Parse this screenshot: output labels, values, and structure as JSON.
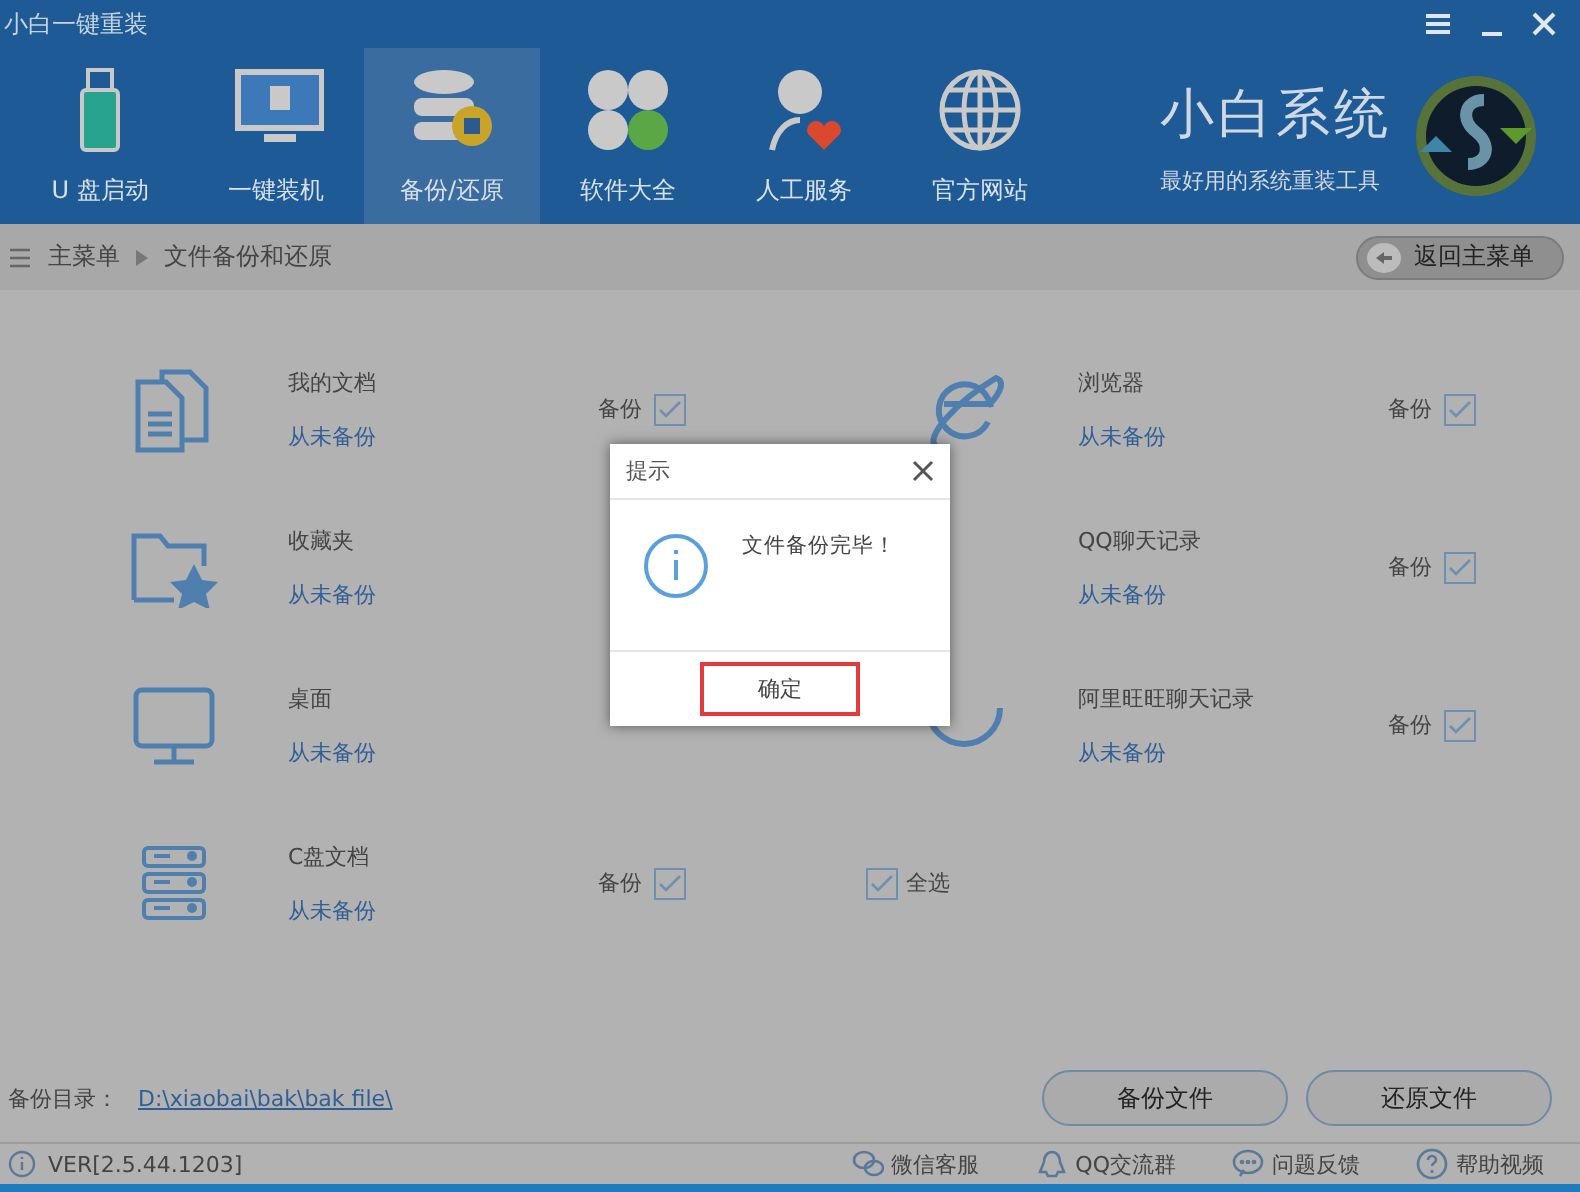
{
  "window": {
    "title": "小白一键重装"
  },
  "nav": [
    {
      "label": "U 盘启动",
      "selected": false
    },
    {
      "label": "一键装机",
      "selected": false
    },
    {
      "label": "备份/还原",
      "selected": true
    },
    {
      "label": "软件大全",
      "selected": false
    },
    {
      "label": "人工服务",
      "selected": false
    },
    {
      "label": "官方网站",
      "selected": false
    }
  ],
  "brand": {
    "name": "小白系统",
    "slogan": "最好用的系统重装工具"
  },
  "breadcrumb": {
    "root": "主菜单",
    "current": "文件备份和还原",
    "back_button": "返回主菜单"
  },
  "items": [
    {
      "name": "我的文档",
      "status": "从未备份",
      "backup_label": "备份",
      "checked": true
    },
    {
      "name": "浏览器",
      "status": "从未备份",
      "backup_label": "备份",
      "checked": true
    },
    {
      "name": "收藏夹",
      "status": "从未备份"
    },
    {
      "name": "QQ聊天记录",
      "status": "从未备份",
      "backup_label": "备份",
      "checked": true
    },
    {
      "name": "桌面",
      "status": "从未备份"
    },
    {
      "name": "阿里旺旺聊天记录",
      "status": "从未备份",
      "backup_label": "备份",
      "checked": true
    },
    {
      "name": "C盘文档",
      "status": "从未备份",
      "backup_label": "备份",
      "checked": true
    }
  ],
  "select_all": {
    "label": "全选",
    "checked": true
  },
  "backup_dir": {
    "label": "备份目录：",
    "path": "D:\\xiaobai\\bak\\bak file\\"
  },
  "buttons": [
    "备份文件",
    "还原文件"
  ],
  "status_bar": {
    "version": "VER[2.5.44.1203]",
    "links": [
      {
        "label": "微信客服"
      },
      {
        "label": "QQ交流群"
      },
      {
        "label": "问题反馈"
      },
      {
        "label": "帮助视频"
      }
    ]
  },
  "dialog": {
    "title": "提示",
    "message": "文件备份完毕！",
    "ok": "确定"
  }
}
